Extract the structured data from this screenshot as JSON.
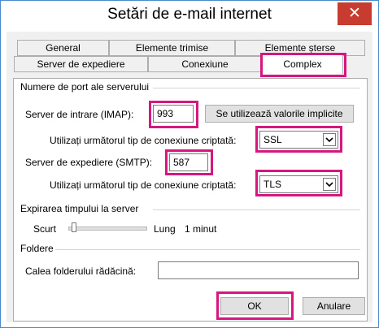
{
  "window": {
    "title": "Setări de e-mail internet",
    "close_glyph": "✕"
  },
  "tabs": {
    "row1": [
      "General",
      "Elemente trimise",
      "Elemente șterse"
    ],
    "row2": [
      "Server de expediere",
      "Conexiune",
      "Complex"
    ],
    "active": "Complex"
  },
  "ports": {
    "section_title": "Numere de port ale serverului",
    "incoming_label": "Server de intrare (IMAP):",
    "incoming_value": "993",
    "defaults_button": "Se utilizează valorile implicite",
    "encryption_label": "Utilizați următorul tip de conexiune criptată:",
    "incoming_encryption": "SSL",
    "outgoing_label": "Server de expediere (SMTP):",
    "outgoing_value": "587",
    "outgoing_encryption": "TLS"
  },
  "timeout": {
    "section_title": "Expirarea timpului la server",
    "short_label": "Scurt",
    "long_label": "Lung",
    "value_text": "1 minut",
    "level_fraction": 0.04
  },
  "folders": {
    "section_title": "Foldere",
    "root_label": "Calea folderului rădăcină:",
    "root_value": ""
  },
  "footer": {
    "ok_label": "OK",
    "cancel_label": "Anulare"
  },
  "colors": {
    "highlight": "#d6177f",
    "close_button": "#c83c2f",
    "window_border": "#4a8ac9"
  }
}
